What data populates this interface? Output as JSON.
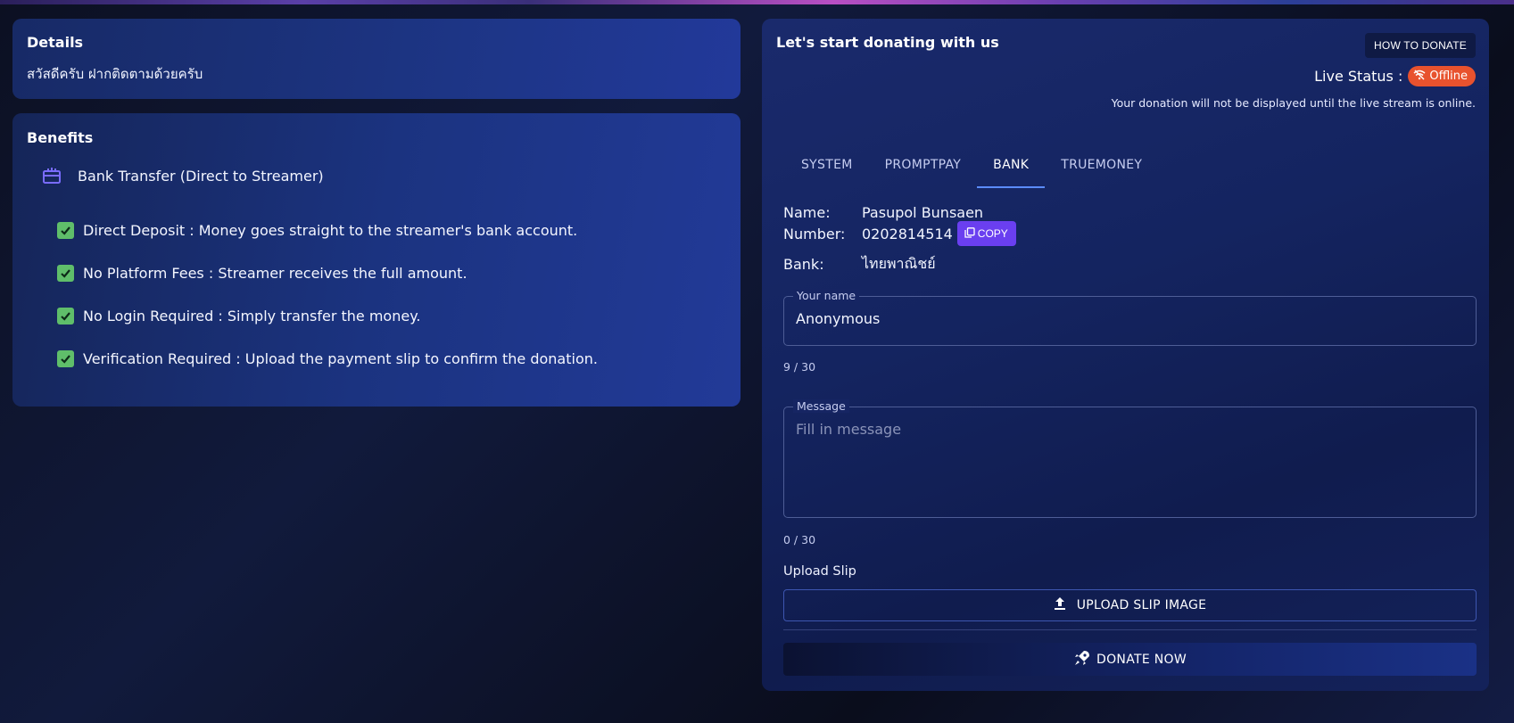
{
  "details": {
    "title": "Details",
    "text": "สวัสดีครับ ฝากติดตามด้วยครับ"
  },
  "benefits": {
    "title": "Benefits",
    "head": "Bank Transfer (Direct to Streamer)",
    "items": [
      "Direct Deposit : Money goes straight to the streamer's bank account.",
      "No Platform Fees : Streamer receives the full amount.",
      "No Login Required : Simply transfer the money.",
      "Verification Required : Upload the payment slip to confirm the donation."
    ]
  },
  "donate_panel": {
    "title": "Let's start donating with us",
    "how_to_donate": "HOW TO DONATE",
    "live_status_label": "Live Status :",
    "live_status_value": "Offline",
    "live_note": "Your donation will not be displayed until the live stream is online.",
    "tabs": [
      "SYSTEM",
      "PROMPTPAY",
      "BANK",
      "TRUEMONEY"
    ],
    "active_tab": "BANK",
    "bank_info": {
      "name_label": "Name:",
      "name_value": "Pasupol Bunsaen",
      "number_label": "Number:",
      "number_value": "0202814514",
      "copy_label": "COPY",
      "bank_label": "Bank:",
      "bank_value": "ไทยพาณิชย์"
    },
    "name_field": {
      "label": "Your name",
      "value": "Anonymous",
      "counter": "9 / 30"
    },
    "message_field": {
      "label": "Message",
      "placeholder": "Fill in message",
      "counter": "0 / 30"
    },
    "upload": {
      "label": "Upload Slip",
      "button": "UPLOAD SLIP IMAGE"
    },
    "donate_button": "DONATE NOW"
  },
  "colors": {
    "accent": "#6a3ff0",
    "offline": "#e8522e",
    "check": "#5fbe6a",
    "tab_indicator": "#5b8cff"
  }
}
